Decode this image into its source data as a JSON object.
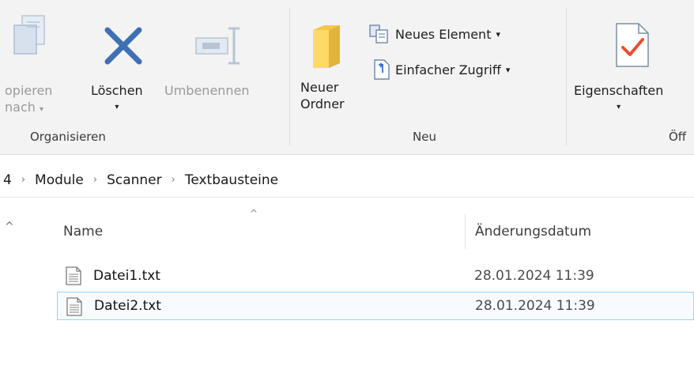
{
  "ribbon": {
    "organisieren": {
      "kopieren_line1": "opieren",
      "kopieren_line2": "nach",
      "kopieren_caret": "▾",
      "loeschen": "Löschen",
      "loeschen_caret": "▾",
      "umbenennen": "Umbenennen",
      "label": "Organisieren"
    },
    "neu": {
      "neuer_ordner_line1": "Neuer",
      "neuer_ordner_line2": "Ordner",
      "neues_element": "Neues Element",
      "neues_element_caret": "▾",
      "einfacher_zugriff": "Einfacher Zugriff",
      "einfacher_zugriff_caret": "▾",
      "label": "Neu"
    },
    "oeffnen": {
      "eigenschaften": "Eigenschaften",
      "eigenschaften_caret": "▾",
      "label": "Öff"
    }
  },
  "address": {
    "crumbs": [
      "4",
      "Module",
      "Scanner",
      "Textbausteine"
    ],
    "separator": "›"
  },
  "list": {
    "up_glyph": "^",
    "sort_glyph": "^",
    "columns": {
      "name": "Name",
      "date": "Änderungsdatum"
    },
    "rows": [
      {
        "name": "Datei1.txt",
        "date": "28.01.2024 11:39",
        "selected": false
      },
      {
        "name": "Datei2.txt",
        "date": "28.01.2024 11:39",
        "selected": true
      }
    ]
  },
  "colors": {
    "selection_border": "#99d1ff",
    "delete_icon": "#3f6fb5",
    "folder_icon": "#f4c64a",
    "check_icon": "#e8502f"
  }
}
